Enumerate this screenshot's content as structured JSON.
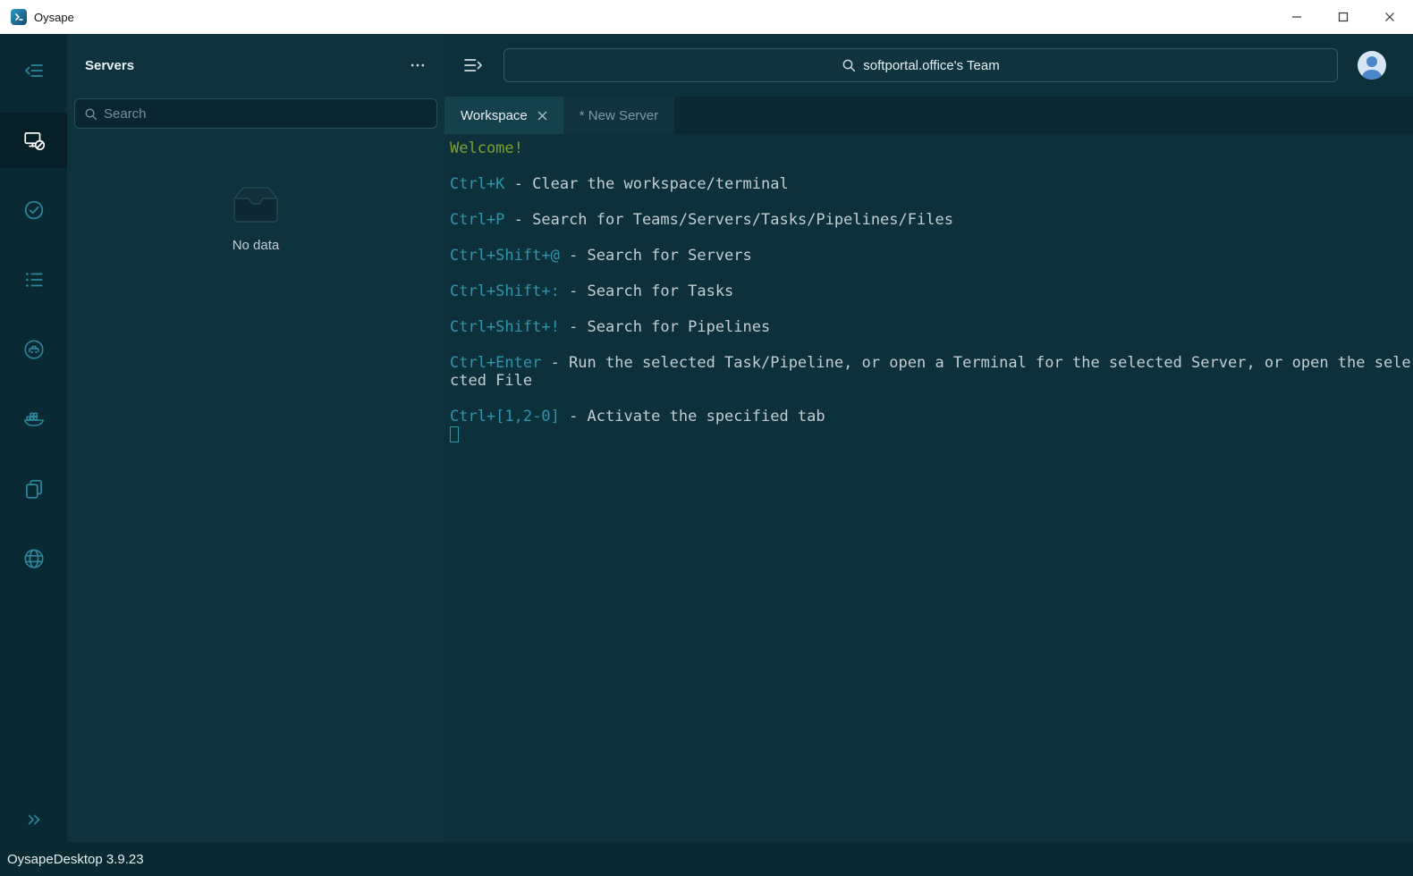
{
  "titlebar": {
    "app_name": "Oysape"
  },
  "topbar": {
    "team_search_label": "softportal.office's Team"
  },
  "sidebar": {
    "title": "Servers",
    "search_placeholder": "Search",
    "empty_text": "No data"
  },
  "tabs": {
    "workspace": {
      "label": "Workspace"
    },
    "new_server": {
      "label": "* New Server"
    }
  },
  "terminal": {
    "welcome": "Welcome!",
    "shortcuts": [
      {
        "key": "Ctrl+K",
        "desc": " - Clear the workspace/terminal"
      },
      {
        "key": "Ctrl+P",
        "desc": " - Search for Teams/Servers/Tasks/Pipelines/Files"
      },
      {
        "key": "Ctrl+Shift+@",
        "desc": " - Search for Servers"
      },
      {
        "key": "Ctrl+Shift+:",
        "desc": " - Search for Tasks"
      },
      {
        "key": "Ctrl+Shift+!",
        "desc": " - Search for Pipelines"
      },
      {
        "key": "Ctrl+Enter",
        "desc": " - Run the selected Task/Pipeline, or open a Terminal for the selected Server, or open the selected File"
      },
      {
        "key": "Ctrl+[1,2-0]",
        "desc": " - Activate the specified tab"
      }
    ]
  },
  "statusbar": {
    "text": "OysapeDesktop 3.9.23"
  },
  "rail": {
    "icons": [
      "toggle-sidebar",
      "servers",
      "tasks",
      "task-list",
      "pipelines",
      "docker",
      "files",
      "globe",
      "expand"
    ],
    "active": "servers"
  },
  "colors": {
    "accent_teal": "#2f94ac",
    "welcome_green": "#7f9f2e",
    "background_main": "#0d313b",
    "titlebar": "#ffffff"
  }
}
